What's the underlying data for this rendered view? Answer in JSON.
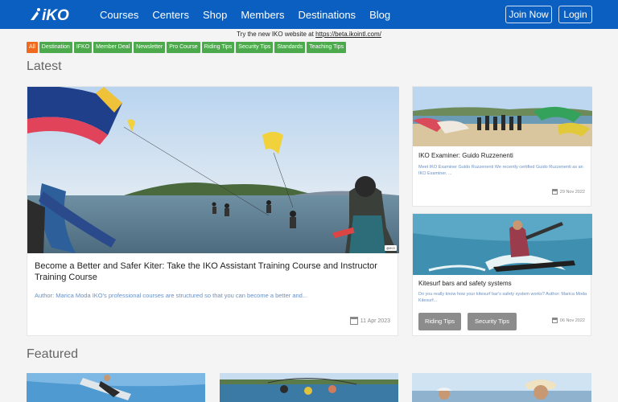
{
  "nav": {
    "logo_text": "iKO",
    "links": [
      "Courses",
      "Centers",
      "Shop",
      "Members",
      "Destinations",
      "Blog"
    ],
    "join_label": "Join Now",
    "login_label": "Login"
  },
  "promo": {
    "text": "Try the new IKO website at ",
    "link": "https://beta.ikointl.com/"
  },
  "tags": [
    "All",
    "Destination",
    "IFKO",
    "Member Deal",
    "Newsletter",
    "Pro Course",
    "Riding Tips",
    "Security Tips",
    "Standards",
    "Teaching Tips"
  ],
  "latest": {
    "heading": "Latest",
    "main": {
      "title": "Become a Better and Safer Kiter: Take the IKO Assistant Training Course and Instructor Training Course",
      "excerpt": "Author: Marica Moda IKO's professional courses are structured so that you can become a better and...",
      "date": "11 Apr 2023",
      "watermark": "@IKO"
    },
    "side1": {
      "title": "IKO Examiner: Guido Ruzzenenti",
      "excerpt": "Meet IKO Examiner Guido Ruzzenenti We recently certified Guido Ruzzenenti as an IKO Examiner. ...",
      "date": "29 Nov 2022"
    },
    "side2": {
      "title": "Kitesurf bars and safety systems",
      "excerpt": "Do you really know how your kitesurf bar's safety system works? Author: Marica Moda Kitesurf...",
      "tags": [
        "Riding Tips",
        "Security Tips"
      ],
      "date": "06 Nov 2022"
    }
  },
  "featured": {
    "heading": "Featured"
  }
}
